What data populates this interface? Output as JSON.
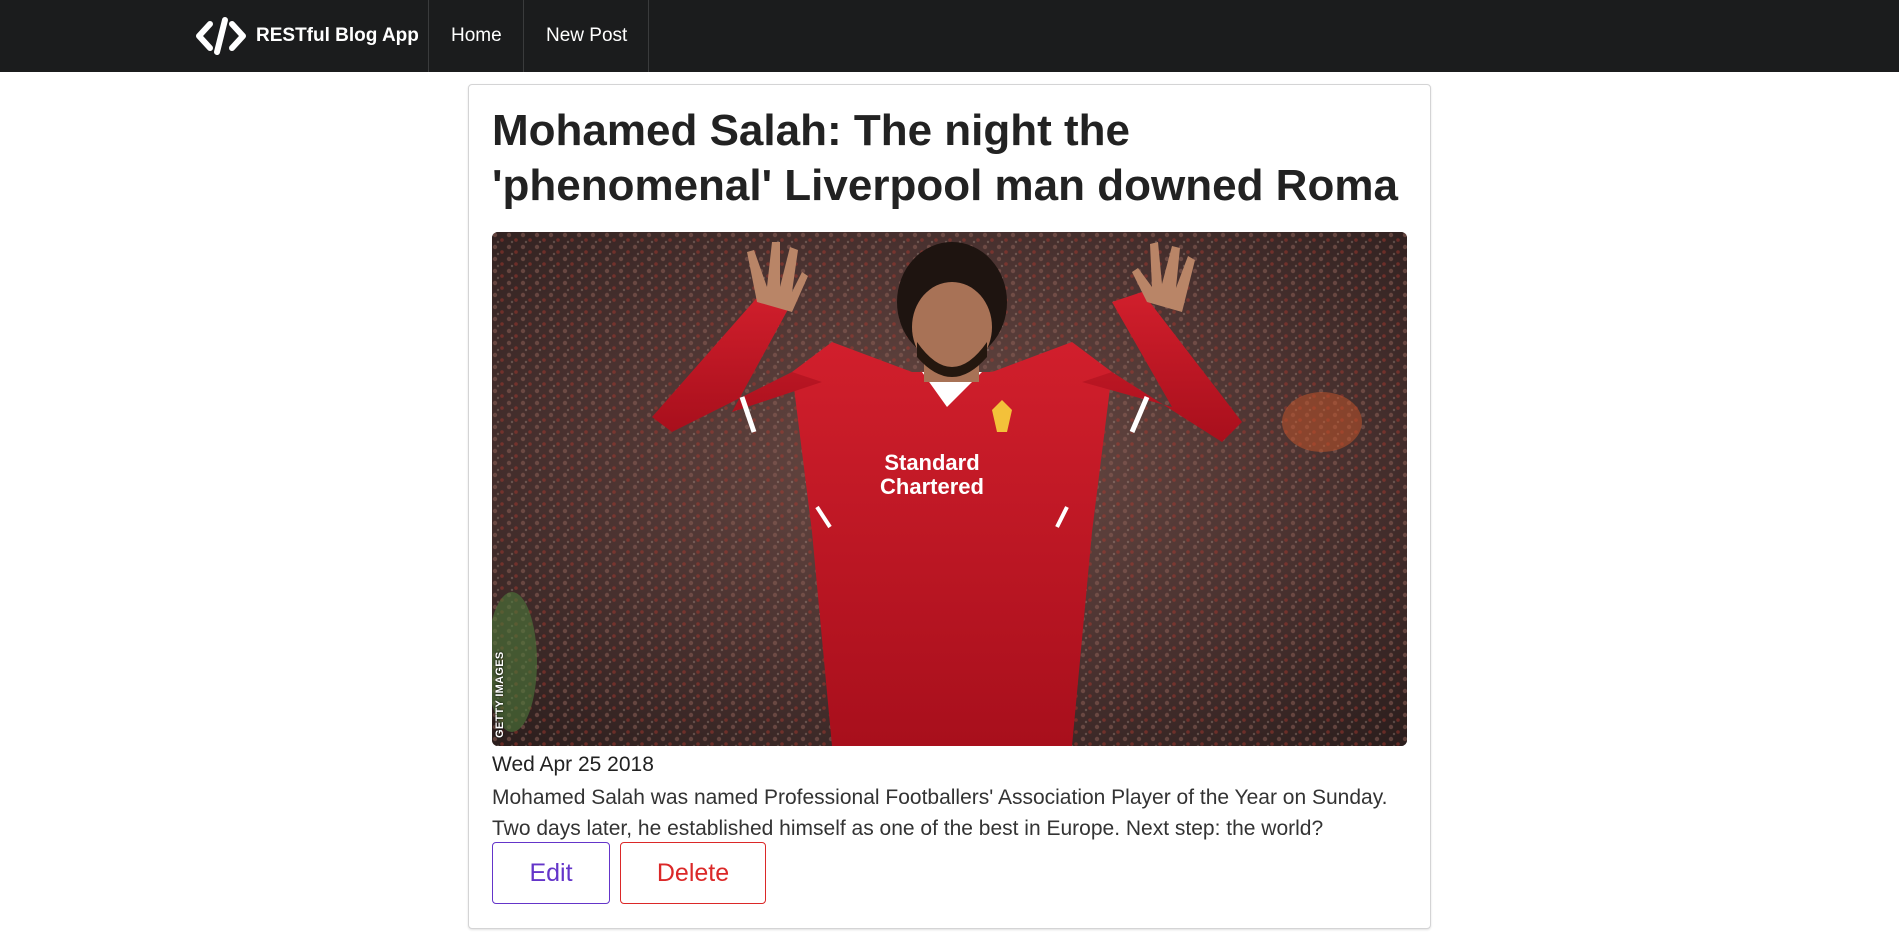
{
  "app": {
    "brand_name": "RESTful Blog App",
    "brand_icon": "code-icon"
  },
  "nav": {
    "items": [
      {
        "label": "Home"
      },
      {
        "label": "New Post"
      }
    ]
  },
  "post": {
    "title": "Mohamed Salah: The night the 'phenomenal' Liverpool man downed Roma",
    "image": {
      "description": "footballer-photo",
      "watermark": "GETTY IMAGES",
      "shirt_text_line1": "Standard",
      "shirt_text_line2": "Chartered"
    },
    "date": "Wed Apr 25 2018",
    "body": "Mohamed Salah was named Professional Footballers' Association Player of the Year on Sunday. Two days later, he established himself as one of the best in Europe. Next step: the world?",
    "edit_label": "Edit",
    "delete_label": "Delete"
  },
  "colors": {
    "navbar_bg": "#1b1c1d",
    "edit_accent": "#6435c9",
    "delete_accent": "#db2828",
    "shirt_red": "#c8102e"
  }
}
